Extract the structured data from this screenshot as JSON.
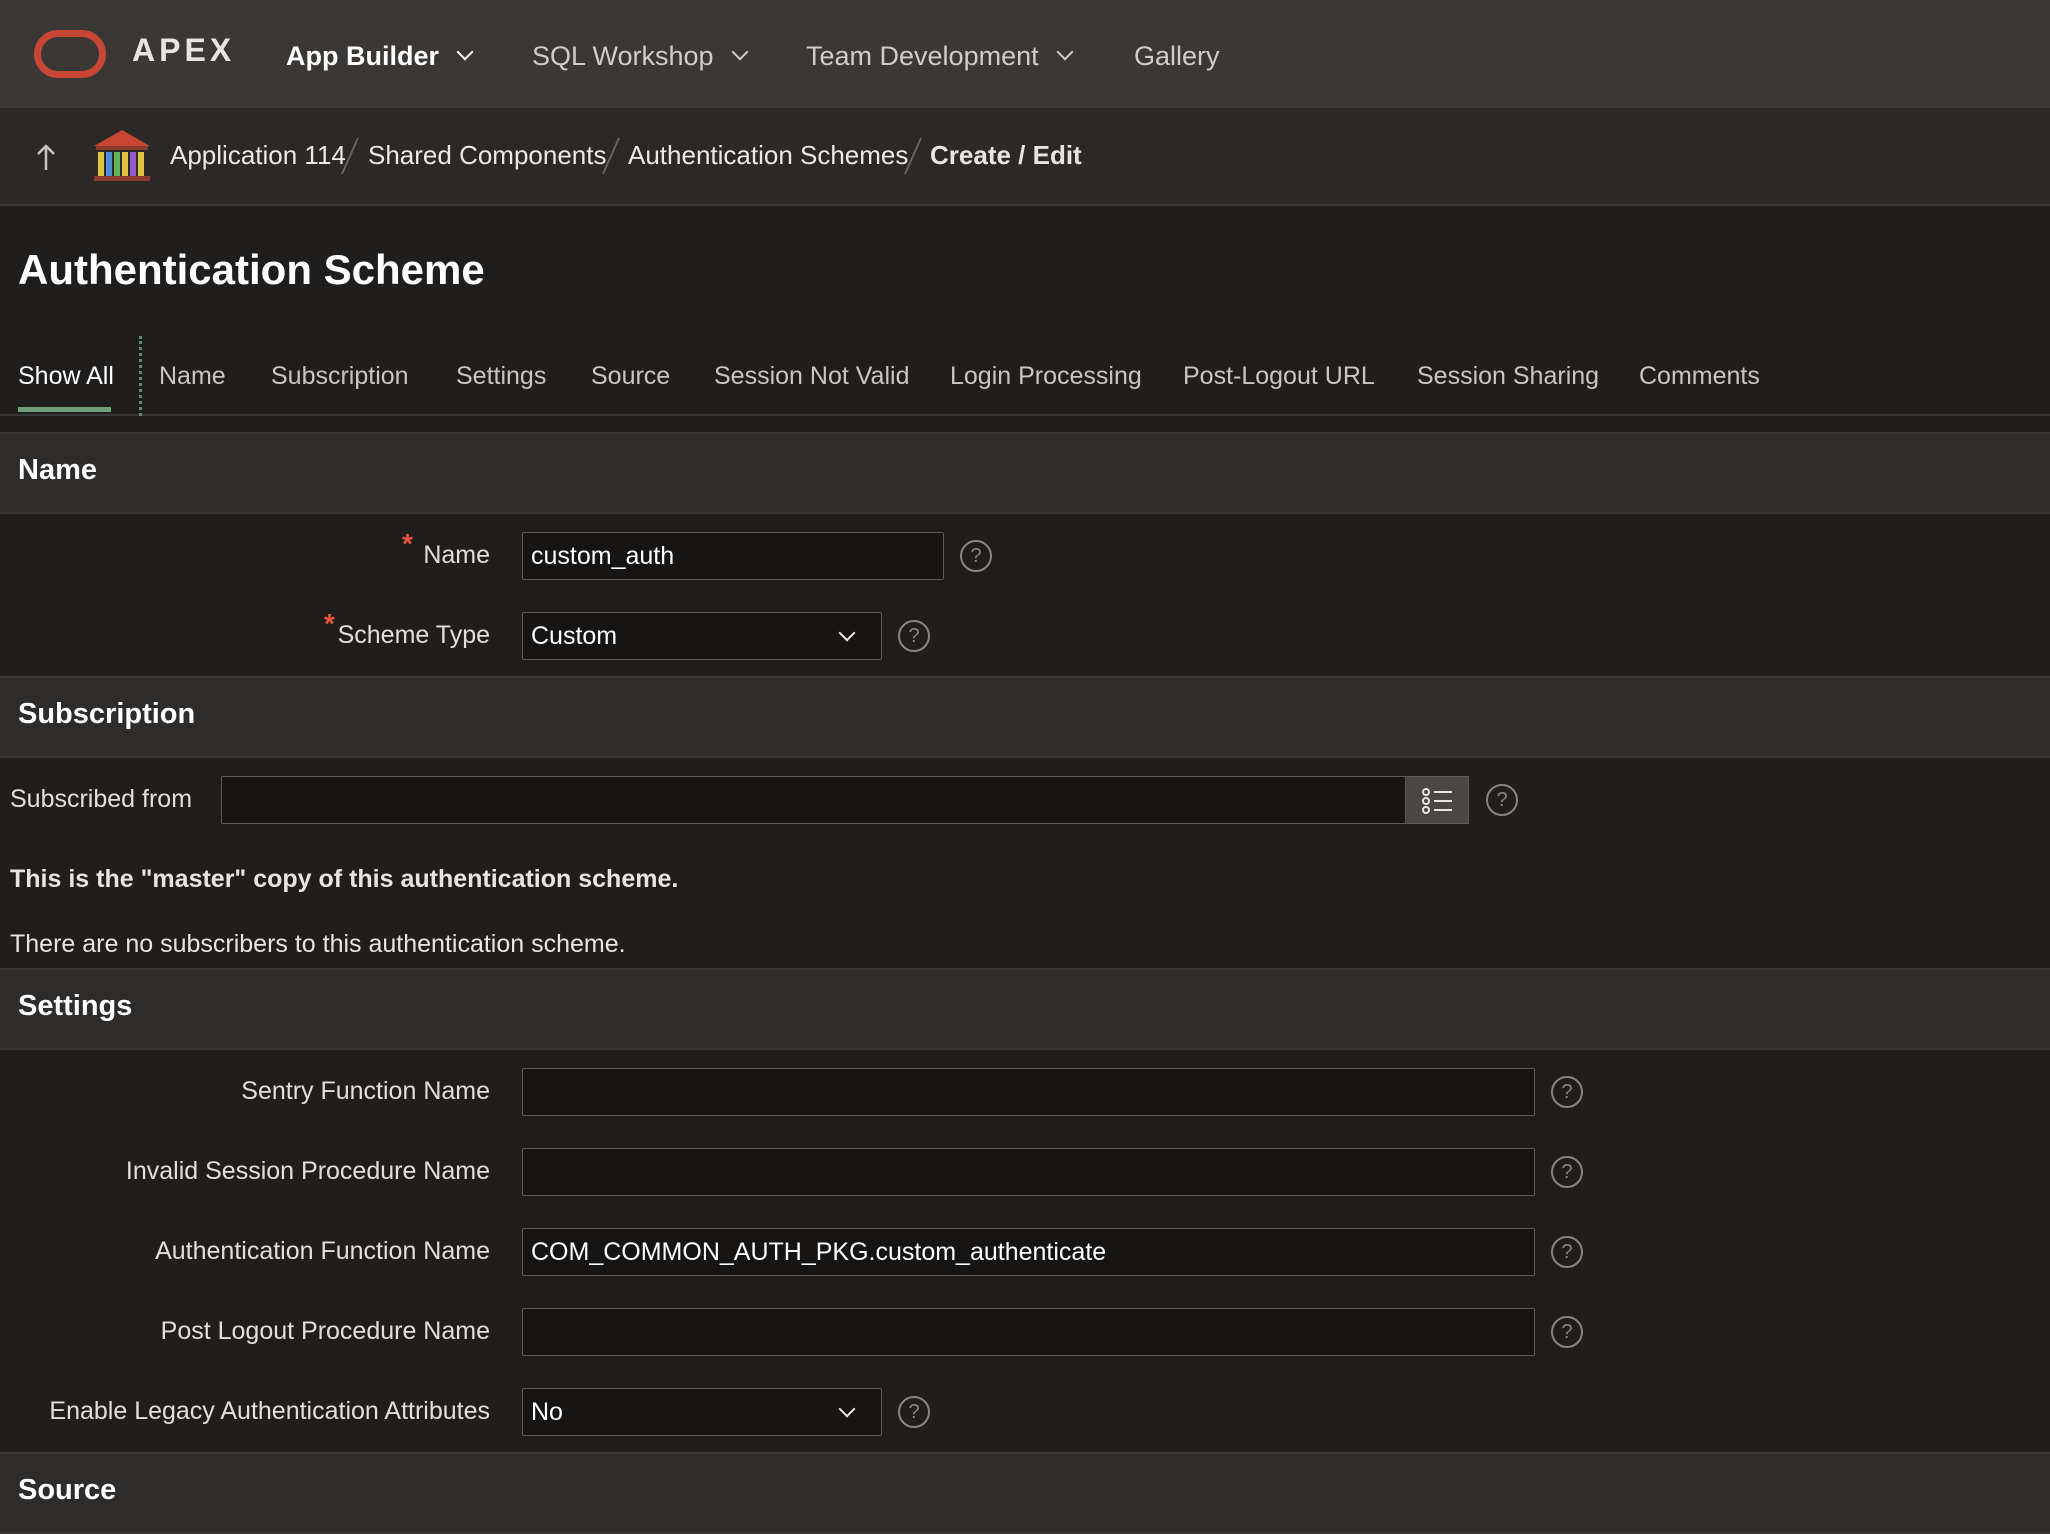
{
  "brand": {
    "logo_text": "APEX"
  },
  "topnav": {
    "items": [
      {
        "label": "App Builder",
        "dropdown": true,
        "active": true
      },
      {
        "label": "SQL Workshop",
        "dropdown": true
      },
      {
        "label": "Team Development",
        "dropdown": true
      },
      {
        "label": "Gallery",
        "dropdown": false
      }
    ]
  },
  "breadcrumb": {
    "items": [
      "Application 114",
      "Shared Components",
      "Authentication Schemes"
    ],
    "current": "Create / Edit"
  },
  "page": {
    "title": "Authentication Scheme"
  },
  "tabs": [
    "Show All",
    "Name",
    "Subscription",
    "Settings",
    "Source",
    "Session Not Valid",
    "Login Processing",
    "Post-Logout URL",
    "Session Sharing",
    "Comments"
  ],
  "sections": {
    "name": {
      "title": "Name",
      "name_label": "Name",
      "name_value": "custom_auth",
      "scheme_type_label": "Scheme Type",
      "scheme_type_value": "Custom"
    },
    "subscription": {
      "title": "Subscription",
      "subscribed_from_label": "Subscribed from",
      "subscribed_from_value": "",
      "master_copy_text": "This is the \"master\" copy of this authentication scheme.",
      "no_subscribers_text": "There are no subscribers to this authentication scheme."
    },
    "settings": {
      "title": "Settings",
      "sentry_label": "Sentry Function Name",
      "sentry_value": "",
      "invalid_session_label": "Invalid Session Procedure Name",
      "invalid_session_value": "",
      "auth_function_label": "Authentication Function Name",
      "auth_function_value": "COM_COMMON_AUTH_PKG.custom_authenticate",
      "post_logout_label": "Post Logout Procedure Name",
      "post_logout_value": "",
      "legacy_label": "Enable Legacy Authentication Attributes",
      "legacy_value": "No"
    },
    "source": {
      "title": "Source"
    }
  },
  "help_symbol": "?",
  "colors": {
    "nav_bg": "#3a3734",
    "page_bg": "#201e1c",
    "accent_tab": "#6f9e79",
    "required": "#e8543c",
    "logo": "#c74634"
  }
}
